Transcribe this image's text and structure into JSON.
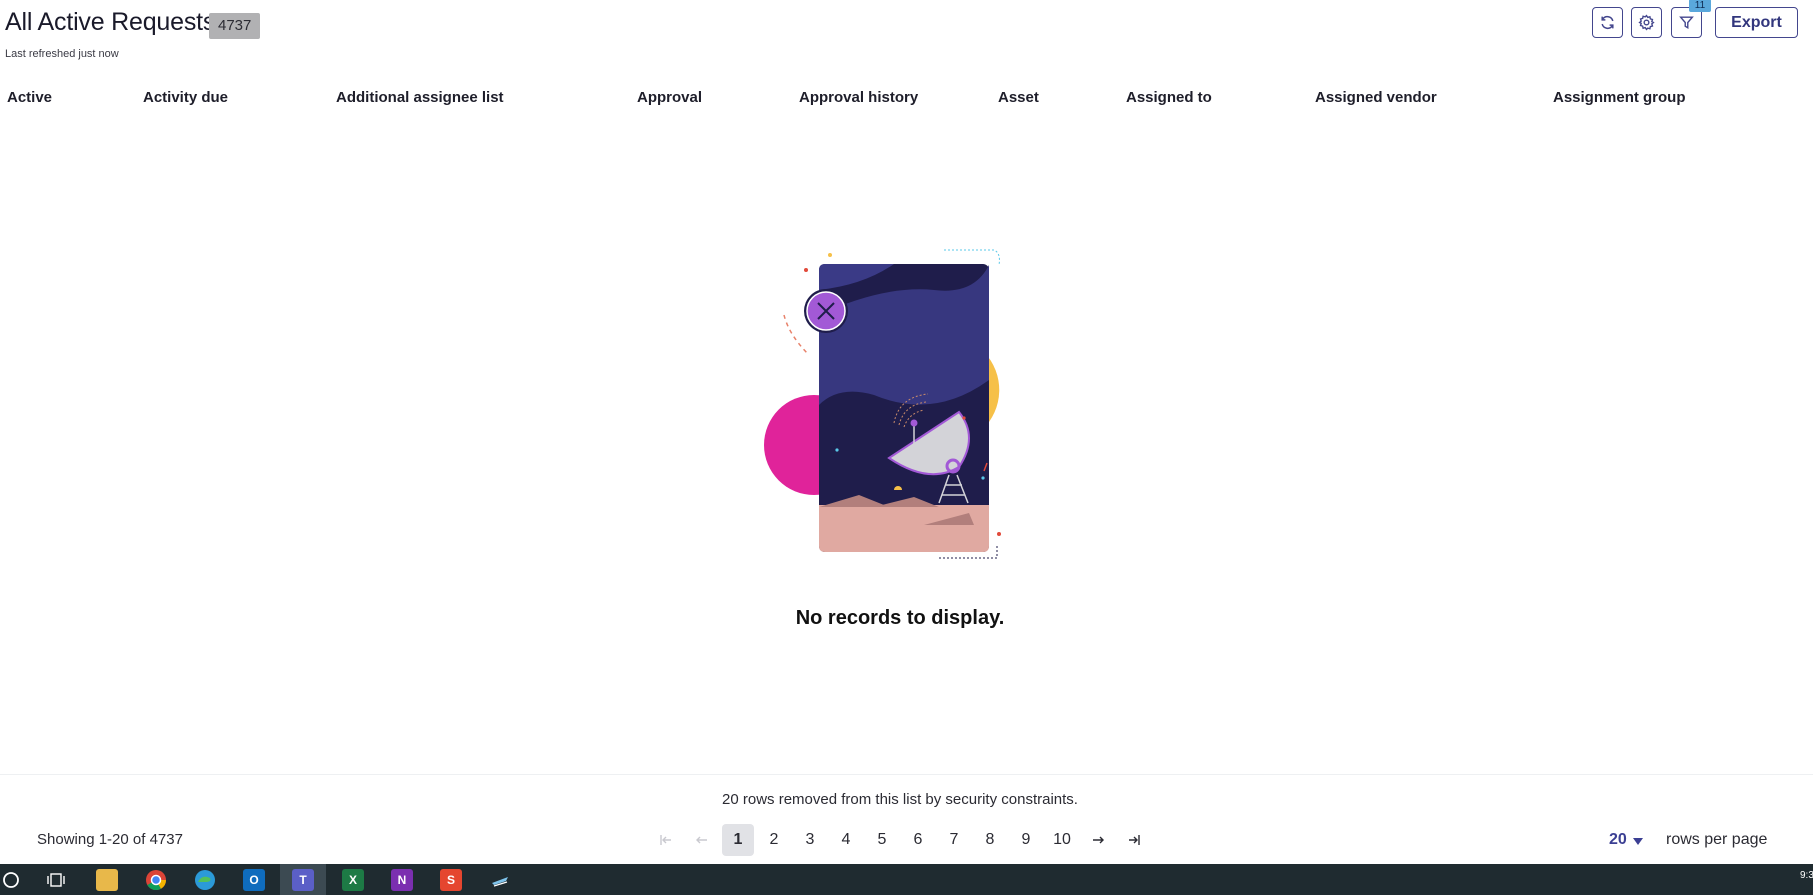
{
  "header": {
    "title": "All Active Requests",
    "count": "4737",
    "refreshed": "Last refreshed just now",
    "filter_count": "11",
    "export_label": "Export",
    "tool_icons": [
      "refresh-icon",
      "gear-icon",
      "filter-icon"
    ]
  },
  "columns": [
    "Active",
    "Activity due",
    "Additional assignee list",
    "Approval",
    "Approval history",
    "Asset",
    "Assigned to",
    "Assigned vendor",
    "Assignment group"
  ],
  "empty_state": {
    "message": "No records to display.",
    "illustration_icon": "satellite-dish-illustration"
  },
  "footer": {
    "security_note": "20 rows removed from this list by security constraints.",
    "showing": "Showing 1-20 of 4737",
    "pages": [
      "1",
      "2",
      "3",
      "4",
      "5",
      "6",
      "7",
      "8",
      "9",
      "10"
    ],
    "current_page": "1",
    "rows_per_page_value": "20",
    "rows_per_page_label": "rows per page"
  },
  "taskbar": {
    "icons": [
      "start-icon",
      "task-view-icon",
      "file-explorer-icon",
      "chrome-icon",
      "edge-icon",
      "outlook-icon",
      "teams-icon",
      "excel-icon",
      "onenote-icon",
      "snagit-icon",
      "app-icon"
    ],
    "clock": "9:3"
  },
  "colors": {
    "accent": "#3b3f93",
    "badge": "#b1b1b3",
    "taskbar": "#1f2b30",
    "illustration_navy": "#1f1d4b",
    "illustration_purple": "#a259d6",
    "illustration_magenta": "#e0239a",
    "illustration_yellow": "#f6c048",
    "illustration_sand": "#e0a9a1"
  }
}
